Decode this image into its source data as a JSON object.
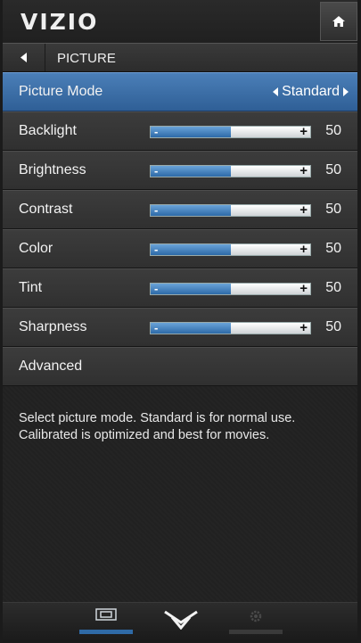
{
  "header": {
    "logo": "VIZIO",
    "home_icon": "home-icon"
  },
  "breadcrumb": {
    "back_icon": "back-triangle-icon",
    "title": "PICTURE"
  },
  "picture_mode": {
    "label": "Picture Mode",
    "value": "Standard"
  },
  "settings": [
    {
      "label": "Backlight",
      "value": "50",
      "level": 0.5
    },
    {
      "label": "Brightness",
      "value": "50",
      "level": 0.5
    },
    {
      "label": "Contrast",
      "value": "50",
      "level": 0.5
    },
    {
      "label": "Color",
      "value": "50",
      "level": 0.5
    },
    {
      "label": "Tint",
      "value": "50",
      "level": 0.5
    },
    {
      "label": "Sharpness",
      "value": "50",
      "level": 0.5
    }
  ],
  "slider_symbols": {
    "minus": "-",
    "plus": "+"
  },
  "advanced": {
    "label": "Advanced"
  },
  "description": "Select picture mode. Standard is for normal use. Calibrated is optimized and best for movies.",
  "bottom_nav": [
    {
      "icon": "screen-icon",
      "active": true
    },
    {
      "icon": "chevron-down-icon",
      "active": false
    },
    {
      "icon": "gear-icon",
      "active": false
    }
  ],
  "colors": {
    "accent_blue": "#2f6aa6",
    "selected_row": "#3d72ad",
    "background": "#222222"
  }
}
